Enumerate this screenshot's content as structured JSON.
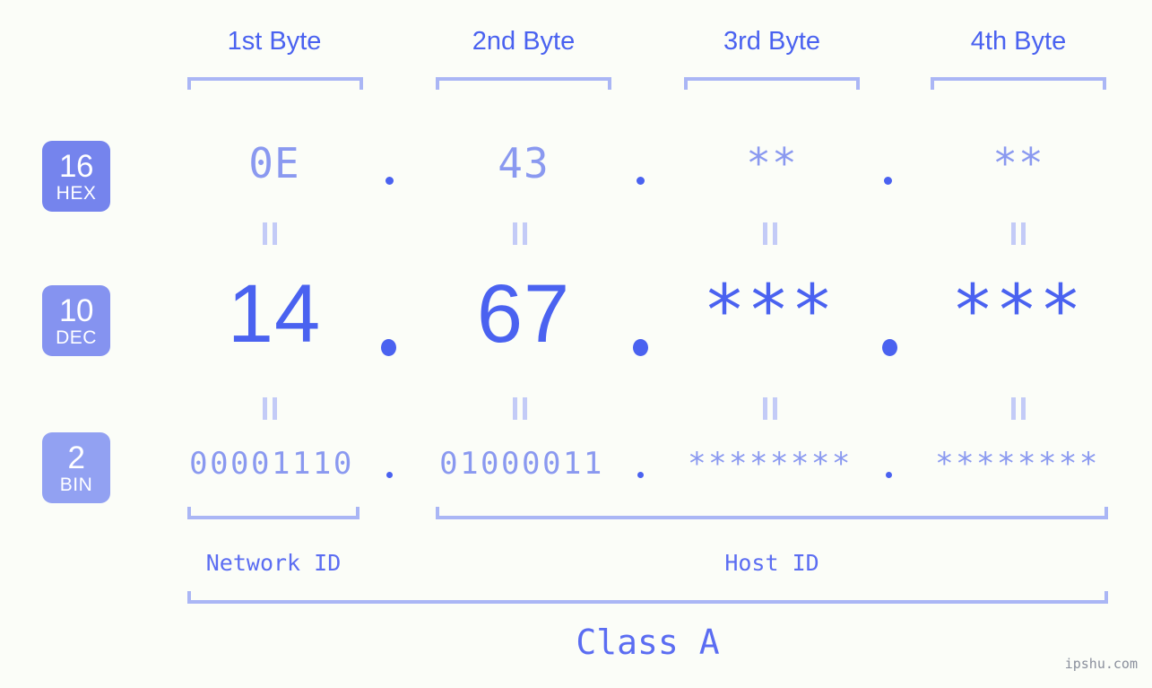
{
  "background_color": "#fbfdf8",
  "accent_color": "#4a62f0",
  "muted_accent_color": "#8a99f0",
  "bracket_color": "#aab6f5",
  "byte_headers": [
    {
      "label": "1st Byte"
    },
    {
      "label": "2nd Byte"
    },
    {
      "label": "3rd Byte"
    },
    {
      "label": "4th Byte"
    }
  ],
  "rows": [
    {
      "base_number": "16",
      "base_name": "HEX",
      "badge_color": "#7584ed",
      "values": [
        "0E",
        "43",
        "**",
        "**"
      ]
    },
    {
      "base_number": "10",
      "base_name": "DEC",
      "badge_color": "#8593f0",
      "values": [
        "14",
        "67",
        "***",
        "***"
      ]
    },
    {
      "base_number": "2",
      "base_name": "BIN",
      "badge_color": "#92a1f2",
      "values": [
        "00001110",
        "01000011",
        "********",
        "********"
      ]
    }
  ],
  "separator": ".",
  "equality_symbol": "=",
  "segments": {
    "network_id": "Network ID",
    "host_id": "Host ID"
  },
  "class_label": "Class A",
  "watermark": "ipshu.com"
}
